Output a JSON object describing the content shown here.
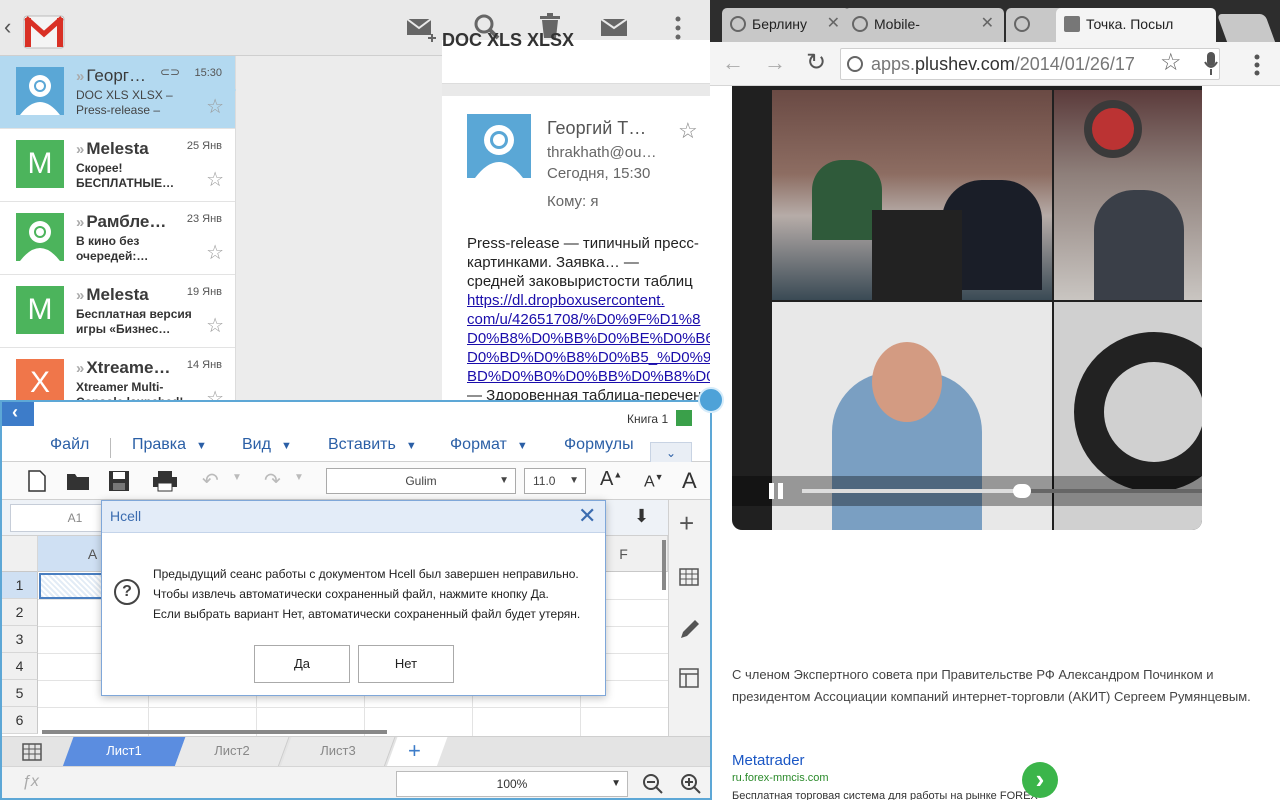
{
  "gmail": {
    "list": [
      {
        "sender": "Георг…",
        "date": "15:30",
        "snippet": "DOC XLS XLSX – Press-release –",
        "selected": true,
        "avatar": "person"
      },
      {
        "sender": "Melesta",
        "date": "25 Янв",
        "snippet": "Скорее! БЕСПЛАТНЫЕ…",
        "selected": false,
        "avatar": "letter",
        "letter": "M"
      },
      {
        "sender": "Рамбле…",
        "date": "23 Янв",
        "snippet": "В кино без очередей:…",
        "selected": false,
        "avatar": "person"
      },
      {
        "sender": "Melesta",
        "date": "19 Янв",
        "snippet": "Бесплатная версия игры «Бизнес…",
        "selected": false,
        "avatar": "letter",
        "letter": "M"
      },
      {
        "sender": "Xtreame…",
        "date": "14 Янв",
        "snippet": "Xtreamer Multi-Console launched!",
        "selected": false,
        "avatar": "letter",
        "letter": "X"
      }
    ],
    "top_subject": "DOC XLS XLSX",
    "reader": {
      "sender_name": "Георгий Т…",
      "sender_email": "thrakhath@ou…",
      "time": "Сегодня, 15:30",
      "to": "Кому: я",
      "body_lines": [
        "Press-release — типичный пресс-",
        "картинками. Заявка… —",
        "средней заковыристости таблиц"
      ],
      "link_lines": [
        "https://dl.dropboxusercontent.",
        "com/u/42651708/%D0%9F%D1%8",
        "D0%B8%D0%BB%D0%BE%D0%B6",
        "D0%BD%D0%B8%D0%B5_%D0%90",
        "BD%D0%B0%D0%BB%D0%B8%D0%"
      ],
      "tail_line": "— Здоровенная таблица-перечен"
    }
  },
  "chrome": {
    "tabs": [
      {
        "title": "Берлину",
        "active": false
      },
      {
        "title": "Mobile-",
        "active": false
      },
      {
        "title": "",
        "active": false
      },
      {
        "title": "Точка. Посыл",
        "active": true
      }
    ],
    "url_prefix": "apps.",
    "url_host": "plushev.com",
    "url_path": "/2014/01/26/17",
    "article": "С членом Экспертного совета при Правительстве РФ Александром Починком и президентом Ассоциации компаний интернет-торговли (АКИТ) Сергеем Румянцевым.",
    "ad": {
      "title": "Metatrader",
      "domain": "ru.forex-mmcis.com",
      "desc": "Бесплатная торговая система для работы на рынке FOREX"
    },
    "video_progress": 0.55
  },
  "hcell": {
    "book_name": "Книга 1",
    "menu": [
      "Файл",
      "Правка",
      "Вид",
      "Вставить",
      "Формат",
      "Формулы"
    ],
    "font_name": "Gulim",
    "font_size": "11.0",
    "cell_ref": "A1",
    "columns": [
      "A",
      "F"
    ],
    "rows": [
      "1",
      "2",
      "3",
      "4",
      "5",
      "6"
    ],
    "sheets": [
      "Лист1",
      "Лист2",
      "Лист3"
    ],
    "zoom": "100%",
    "dialog": {
      "title": "Hcell",
      "lines": [
        "Предыдущий сеанс работы с документом Hcell был завершен неправильно.",
        "Чтобы извлечь автоматически сохраненный файл, нажмите кнопку Да.",
        "Если выбрать вариант Нет, автоматически сохраненный файл будет утерян."
      ],
      "yes": "Да",
      "no": "Нет"
    }
  },
  "colors": {
    "selection": "#b3d9f0",
    "hcell_accent": "#2b5fa6",
    "handle": "#4ea2d8",
    "avatar_blue": "#5aa7d6",
    "avatar_green": "#4cb45c",
    "avatar_orange": "#f0764a"
  }
}
